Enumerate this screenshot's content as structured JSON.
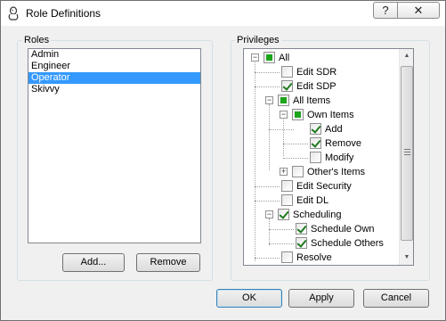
{
  "window": {
    "title": "Role Definitions",
    "help_label": "?",
    "close_label": "✕"
  },
  "roles": {
    "group_label": "Roles",
    "items": [
      {
        "label": "Admin",
        "selected": false
      },
      {
        "label": "Engineer",
        "selected": false
      },
      {
        "label": "Operator",
        "selected": true
      },
      {
        "label": "Skivvy",
        "selected": false
      }
    ],
    "add_label": "Add...",
    "remove_label": "Remove"
  },
  "privileges": {
    "group_label": "Privileges",
    "tree": [
      {
        "label": "All",
        "state": "partial"
      },
      {
        "label": "Edit SDR",
        "state": "unchecked"
      },
      {
        "label": "Edit SDP",
        "state": "checked"
      },
      {
        "label": "All Items",
        "state": "partial"
      },
      {
        "label": "Own Items",
        "state": "partial"
      },
      {
        "label": "Add",
        "state": "checked"
      },
      {
        "label": "Remove",
        "state": "checked"
      },
      {
        "label": "Modify",
        "state": "unchecked"
      },
      {
        "label": "Other's Items",
        "state": "unchecked"
      },
      {
        "label": "Edit Security",
        "state": "unchecked"
      },
      {
        "label": "Edit DL",
        "state": "unchecked"
      },
      {
        "label": "Scheduling",
        "state": "checked"
      },
      {
        "label": "Schedule Own",
        "state": "checked"
      },
      {
        "label": "Schedule Others",
        "state": "checked"
      },
      {
        "label": "Resolve",
        "state": "unchecked"
      }
    ]
  },
  "buttons": {
    "ok_label": "OK",
    "apply_label": "Apply",
    "cancel_label": "Cancel"
  },
  "colors": {
    "selection": "#3399ff",
    "check": "#1f7a1f",
    "partial": "#1aa51a"
  }
}
